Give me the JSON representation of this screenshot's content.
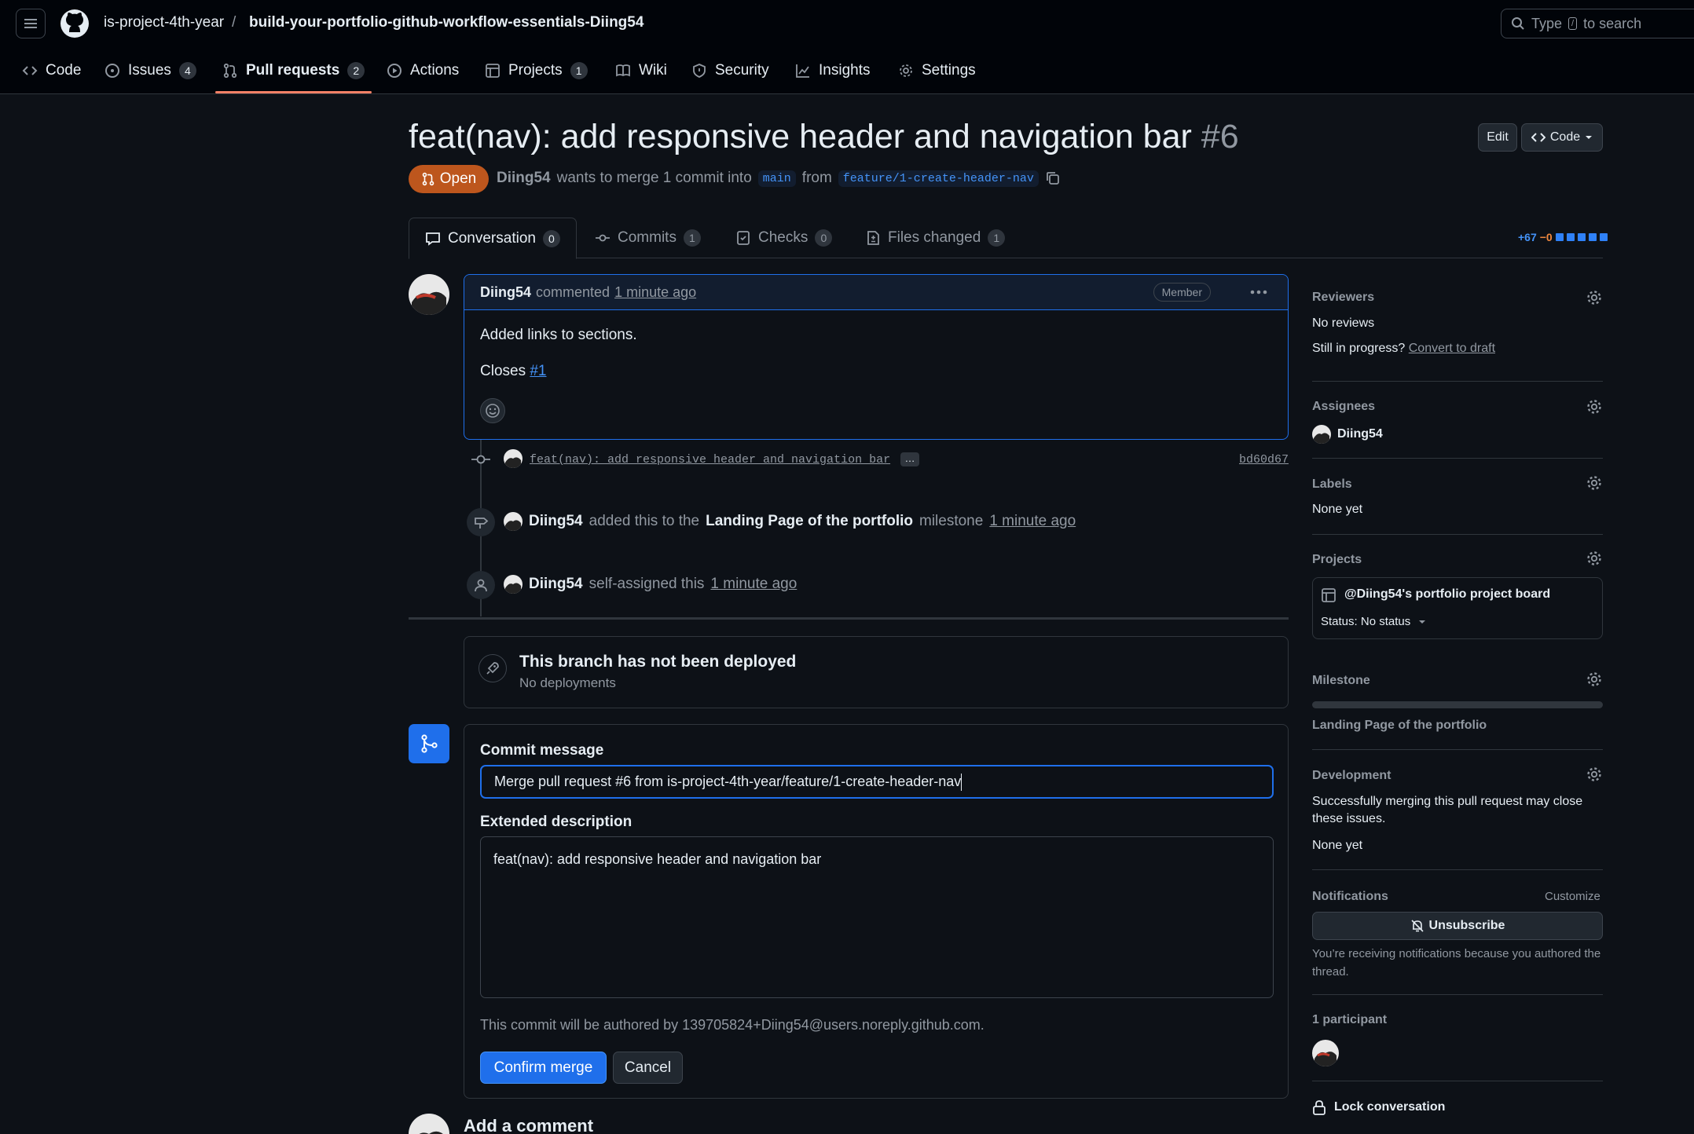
{
  "header": {
    "owner": "is-project-4th-year",
    "separator": "/",
    "repo": "build-your-portfolio-github-workflow-essentials-Diing54",
    "search_placeholder_prefix": "Type",
    "search_key": "/",
    "search_placeholder_suffix": "to search"
  },
  "repo_tabs": [
    {
      "label": "Code",
      "icon": "code-icon"
    },
    {
      "label": "Issues",
      "count": "4",
      "icon": "issue-icon"
    },
    {
      "label": "Pull requests",
      "count": "2",
      "icon": "pull-request-icon",
      "active": true
    },
    {
      "label": "Actions",
      "icon": "play-icon"
    },
    {
      "label": "Projects",
      "count": "1",
      "icon": "table-icon"
    },
    {
      "label": "Wiki",
      "icon": "book-icon"
    },
    {
      "label": "Security",
      "icon": "shield-icon"
    },
    {
      "label": "Insights",
      "icon": "graph-icon"
    },
    {
      "label": "Settings",
      "icon": "gear-icon"
    }
  ],
  "pr": {
    "title": "feat(nav): add responsive header and navigation bar",
    "number": "#6",
    "state": "Open",
    "author": "Diing54",
    "merge_text": "wants to merge 1 commit into",
    "base": "main",
    "from_text": "from",
    "head": "feature/1-create-header-nav",
    "edit_label": "Edit",
    "code_label": "Code"
  },
  "pr_tabs": [
    {
      "label": "Conversation",
      "count": "0",
      "icon": "comment-icon"
    },
    {
      "label": "Commits",
      "count": "1",
      "icon": "commit-icon"
    },
    {
      "label": "Checks",
      "count": "0",
      "icon": "checklist-icon"
    },
    {
      "label": "Files changed",
      "count": "1",
      "icon": "file-diff-icon"
    }
  ],
  "diffstat": {
    "added": "+67",
    "removed": "−0",
    "accent": "#2f81f7"
  },
  "comment": {
    "author": "Diing54",
    "action": "commented",
    "time": "1 minute ago",
    "role": "Member",
    "body_line1": "Added links to sections.",
    "closes_label": "Closes",
    "closes_ref": "#1"
  },
  "timeline": {
    "commit_message": "feat(nav): add responsive header and navigation bar",
    "commit_ellipsis": "…",
    "commit_sha": "bd60d67",
    "milestone_event": {
      "author": "Diing54",
      "text": "added this to the",
      "milestone": "Landing Page of the portfolio",
      "suffix": "milestone",
      "time": "1 minute ago"
    },
    "assign_event": {
      "author": "Diing54",
      "text": "self-assigned this",
      "time": "1 minute ago"
    }
  },
  "deploy": {
    "title": "This branch has not been deployed",
    "subtitle": "No deployments"
  },
  "merge_form": {
    "commit_label": "Commit message",
    "commit_value": "Merge pull request #6 from is-project-4th-year/feature/1-create-header-nav",
    "desc_label": "Extended description",
    "desc_value": "feat(nav): add responsive header and navigation bar",
    "authored_note": "This commit will be authored by 139705824+Diing54@users.noreply.github.com.",
    "confirm_label": "Confirm merge",
    "cancel_label": "Cancel"
  },
  "add_comment_label": "Add a comment",
  "sidebar": {
    "reviewers_title": "Reviewers",
    "reviewers_value": "No reviews",
    "in_progress": "Still in progress?",
    "convert_draft": "Convert to draft",
    "assignees_title": "Assignees",
    "assignee": "Diing54",
    "labels_title": "Labels",
    "labels_value": "None yet",
    "projects_title": "Projects",
    "project_name": "@Diing54's portfolio project board",
    "project_status": "Status: No status",
    "milestone_title": "Milestone",
    "milestone_name": "Landing Page of the portfolio",
    "development_title": "Development",
    "development_text": "Successfully merging this pull request may close these issues.",
    "development_value": "None yet",
    "notifications_title": "Notifications",
    "customize": "Customize",
    "unsubscribe": "Unsubscribe",
    "notif_reason": "You’re receiving notifications because you authored the thread.",
    "participants_title": "1 participant",
    "lock": "Lock conversation"
  }
}
